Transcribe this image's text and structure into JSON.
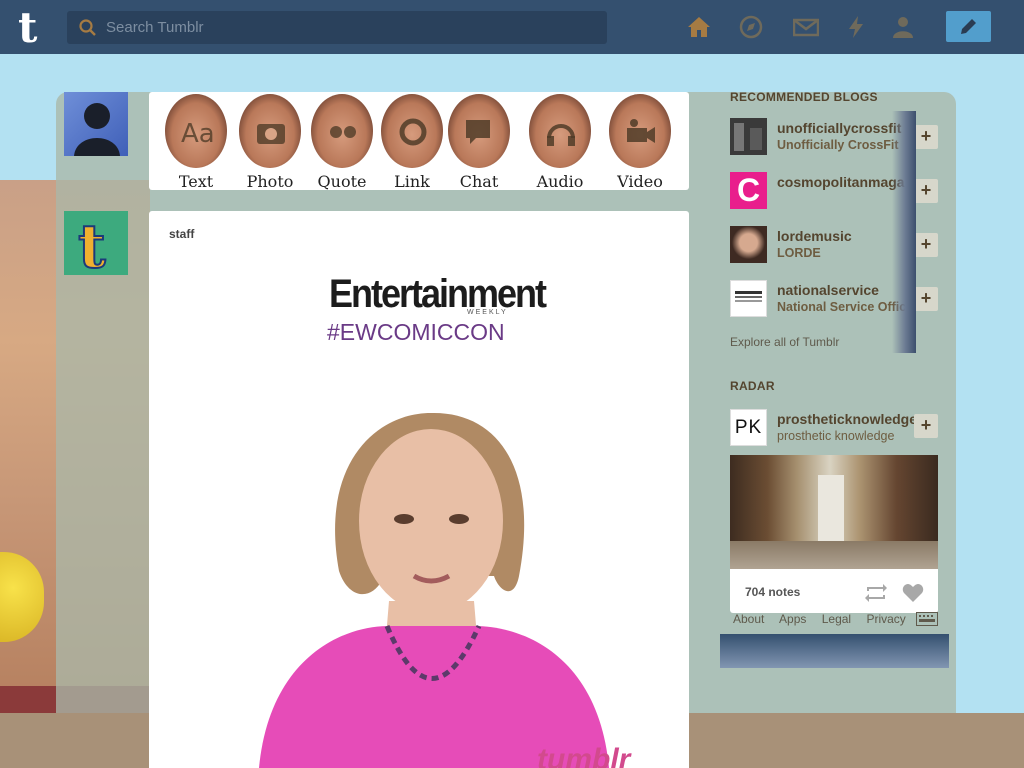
{
  "search": {
    "placeholder": "Search Tumblr"
  },
  "nav": {
    "icons": [
      "home-icon",
      "explore-icon",
      "inbox-icon",
      "activity-icon",
      "account-icon"
    ],
    "compose_icon": "pencil-icon"
  },
  "post_types": [
    {
      "label": "Text",
      "icon": "text-icon"
    },
    {
      "label": "Photo",
      "icon": "camera-icon"
    },
    {
      "label": "Quote",
      "icon": "quote-icon"
    },
    {
      "label": "Link",
      "icon": "link-icon"
    },
    {
      "label": "Chat",
      "icon": "chat-icon"
    },
    {
      "label": "Audio",
      "icon": "headphones-icon"
    },
    {
      "label": "Video",
      "icon": "video-camera-icon"
    }
  ],
  "post": {
    "author": "staff",
    "brand_title": "Entertainment",
    "brand_sub": "WEEKLY",
    "hashtag": "#EWCOMICCON",
    "watermark": "tumblr"
  },
  "sidebar": {
    "recommended_heading": "RECOMMENDED BLOGS",
    "recommended": [
      {
        "name": "unofficiallycrossfit",
        "title": "Unofficially CrossFit",
        "avatar_color": "#3a3a3a"
      },
      {
        "name": "cosmopolitanmagazine",
        "title": "",
        "avatar_color": "#e91e8c",
        "avatar_letter": "C"
      },
      {
        "name": "lordemusic",
        "title": "LORDE",
        "avatar_color": "#6b4f43"
      },
      {
        "name": "nationalservice",
        "title": "National Service Office",
        "avatar_color": "#ffffff"
      }
    ],
    "explore_link": "Explore all of Tumblr",
    "radar_heading": "RADAR",
    "radar": {
      "name": "prostheticknowledge",
      "title": "prosthetic knowledge",
      "avatar_text": "PK",
      "notes": "704 notes"
    },
    "follow_label": "+"
  },
  "footer": [
    "About",
    "Apps",
    "Legal",
    "Privacy"
  ],
  "colors": {
    "topbar": "#34506f",
    "accent": "#529ecc",
    "background": "#b3e1f2"
  }
}
